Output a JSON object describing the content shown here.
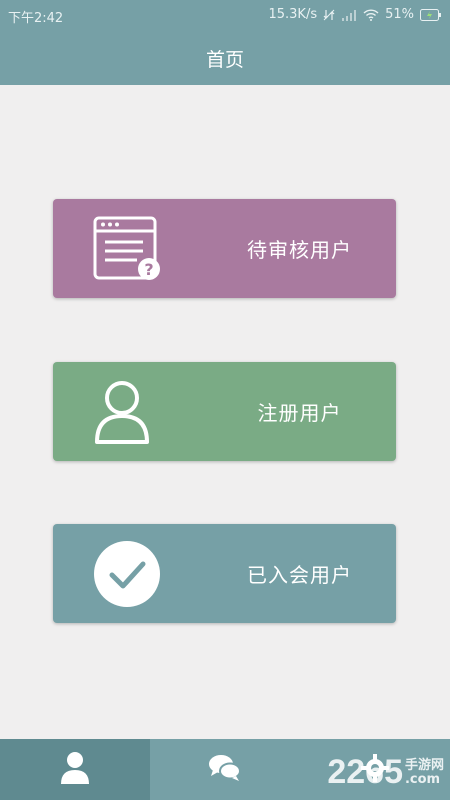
{
  "status_bar": {
    "time": "下午2:42",
    "network_speed": "15.3K/s",
    "battery": "51%"
  },
  "header": {
    "title": "首页"
  },
  "cards": [
    {
      "label": "待审核用户",
      "icon": "pending-review-icon",
      "color": "#a97a9f"
    },
    {
      "label": "注册用户",
      "icon": "user-icon",
      "color": "#7aab85"
    },
    {
      "label": "已入会用户",
      "icon": "check-circle-icon",
      "color": "#76a0a6"
    }
  ],
  "tabbar": {
    "tabs": [
      {
        "icon": "user-icon",
        "active": true
      },
      {
        "icon": "chat-icon",
        "active": false
      },
      {
        "icon": "settings-icon",
        "active": false
      }
    ]
  },
  "watermark": {
    "text": "2265",
    "site": "手游网",
    "domain": ".com"
  },
  "theme": {
    "primary": "#76a0a6",
    "background": "#f0efef",
    "pending": "#a97a9f",
    "registered": "#7aab85"
  }
}
